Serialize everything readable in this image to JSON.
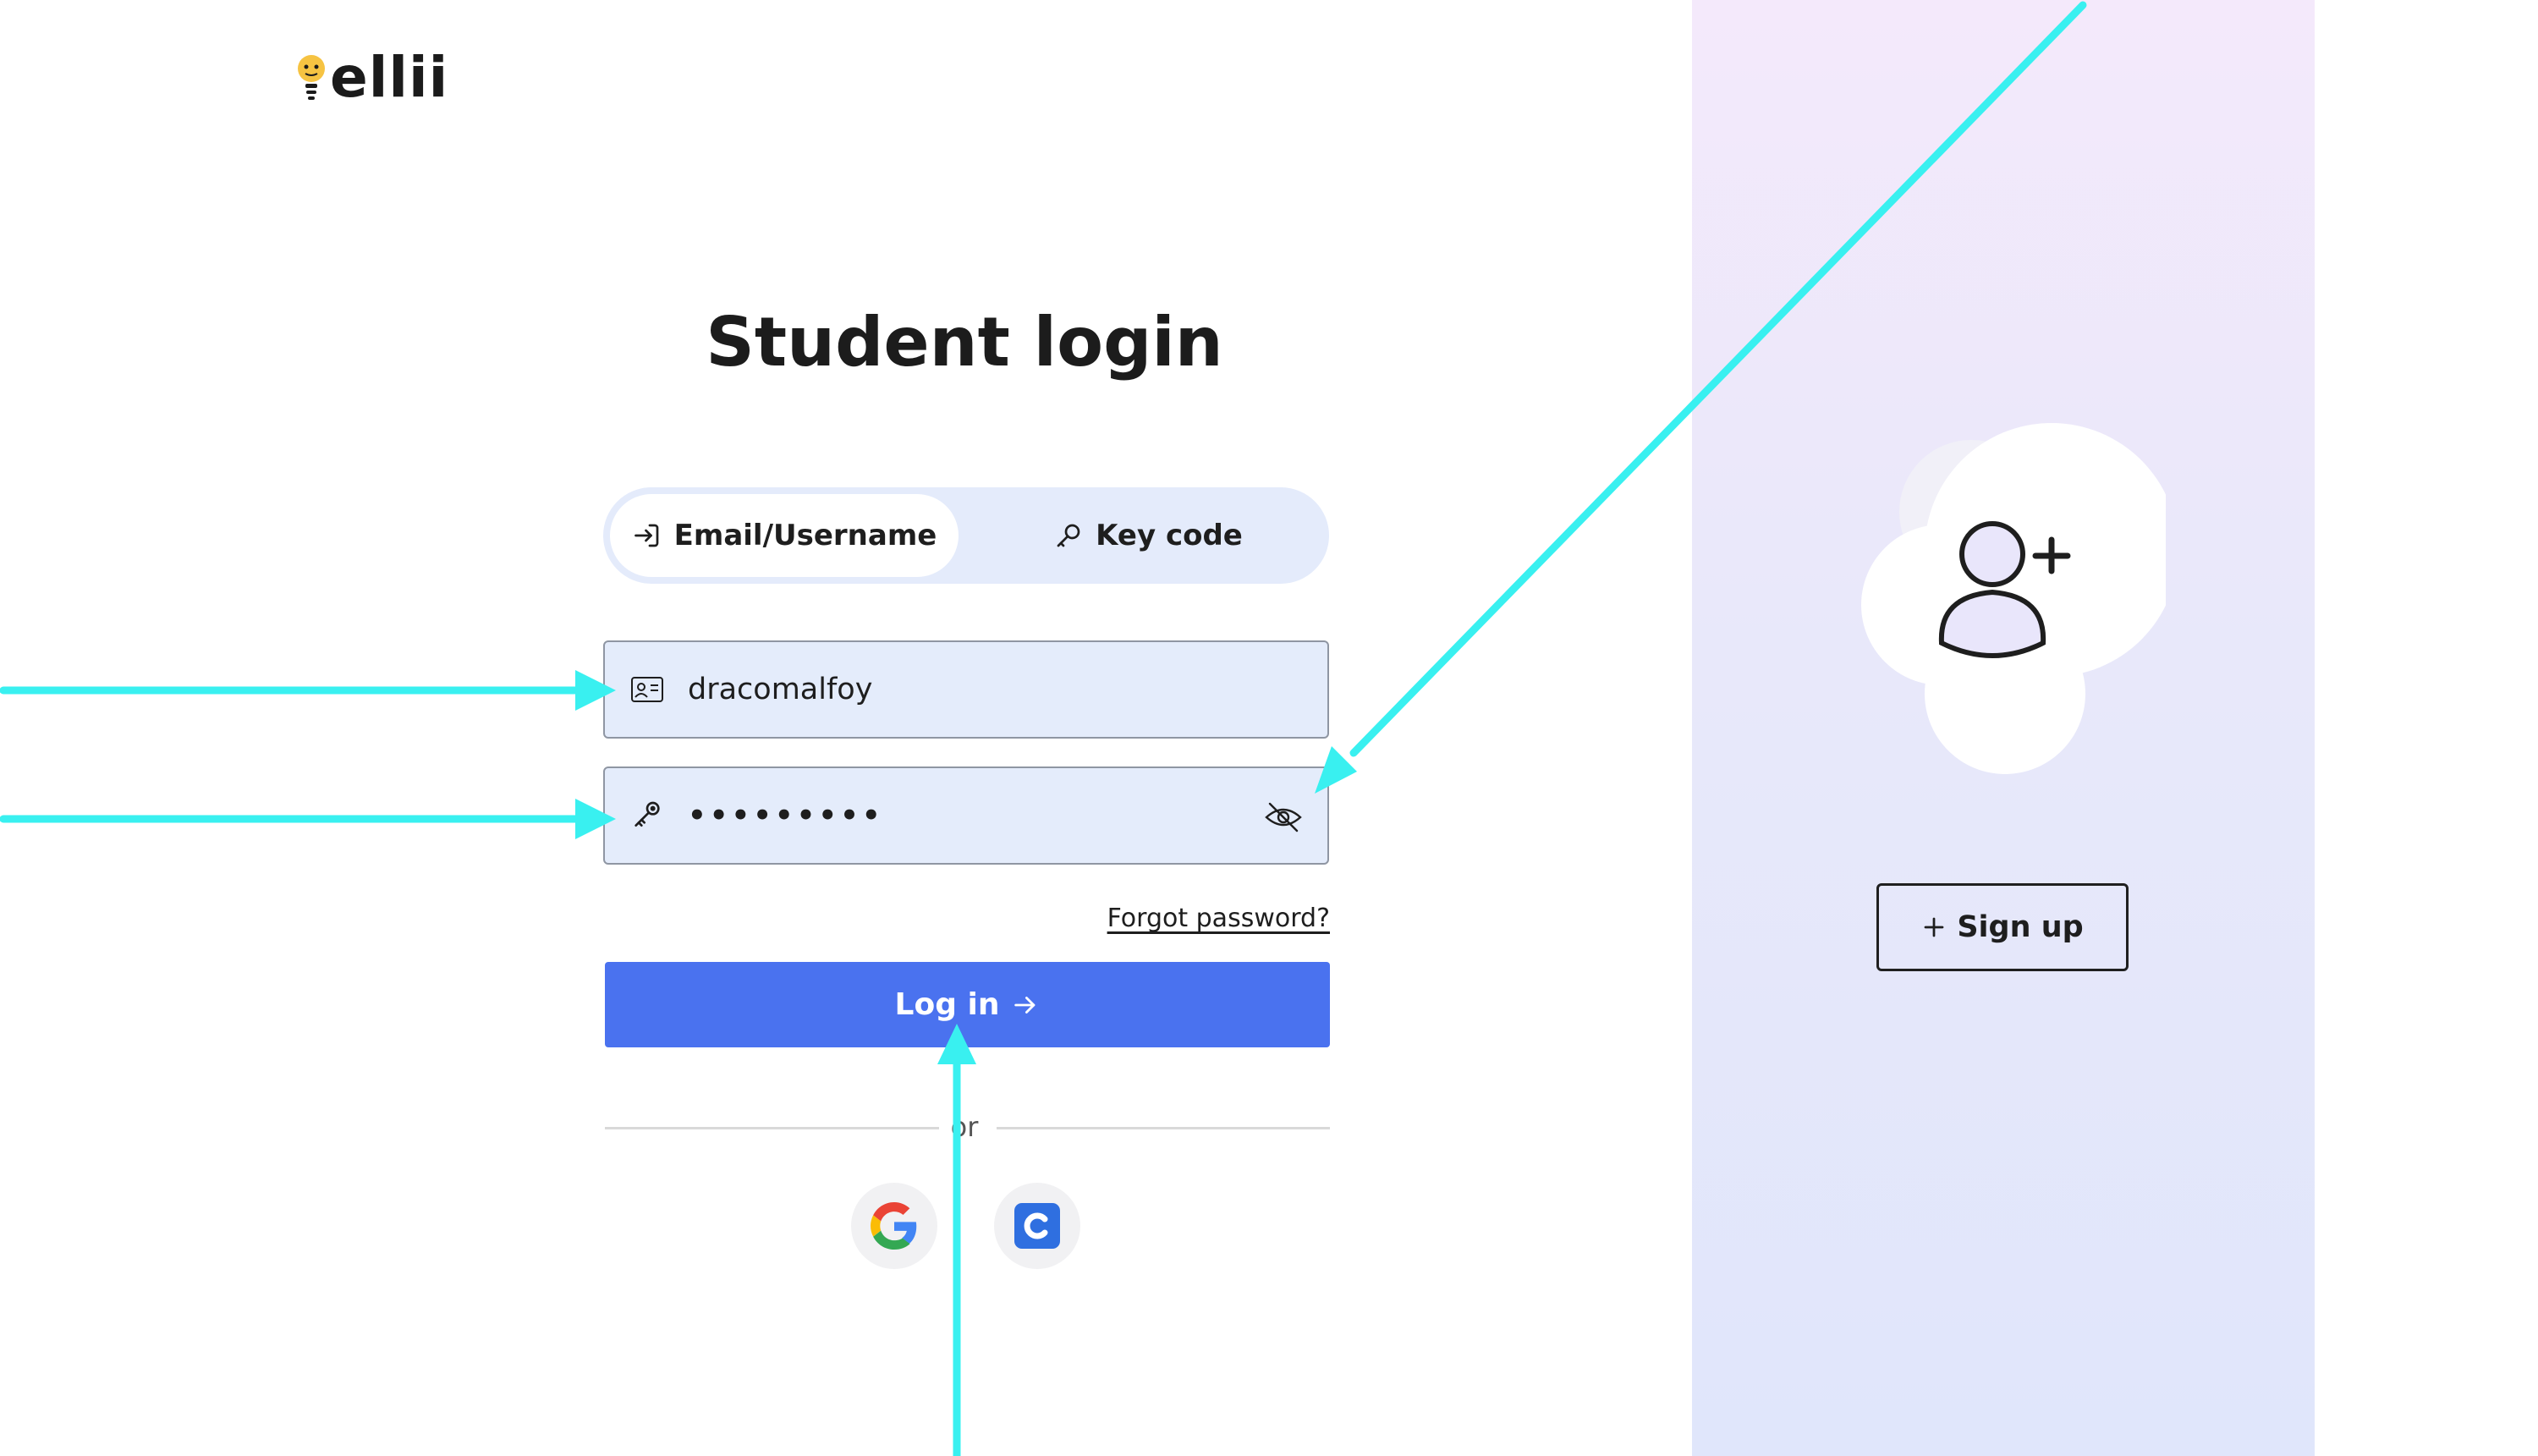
{
  "logo": {
    "text": "ellii"
  },
  "page_title": "Student login",
  "tabs": [
    {
      "label": "Email/Username",
      "icon": "login-icon",
      "active": true
    },
    {
      "label": "Key code",
      "icon": "key-icon",
      "active": false
    }
  ],
  "username_field": {
    "value": "dracomalfoy",
    "icon": "id-card-icon"
  },
  "password_field": {
    "value": "•••••••••",
    "icon": "key-icon",
    "toggle_icon": "eye-off-icon"
  },
  "forgot_password": "Forgot password?",
  "login_button": {
    "label": "Log in",
    "icon": "arrow-right-icon"
  },
  "divider_text": "or",
  "social": [
    {
      "name": "google",
      "icon": "google-icon"
    },
    {
      "name": "classlink",
      "icon": "classlink-icon",
      "letter": "C"
    }
  ],
  "signup_button": {
    "label": "Sign up",
    "icon": "plus-icon"
  },
  "colors": {
    "primary": "#4a72ef",
    "field_bg": "#e4ecfb",
    "annotation_arrow": "#39f0f0",
    "logo_bulb": "#f6c342"
  }
}
